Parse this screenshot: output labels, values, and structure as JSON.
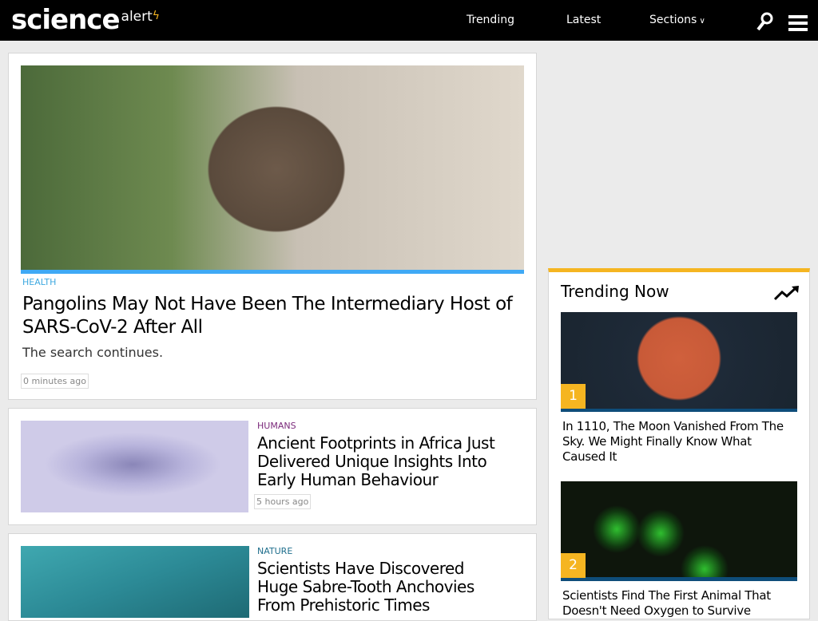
{
  "header": {
    "logo_main": "science",
    "logo_sub": "alert",
    "nav": [
      "Trending",
      "Latest",
      "Sections"
    ]
  },
  "featured": {
    "category": "HEALTH",
    "title": "Pangolins May Not Have Been The Intermediary Host of SARS-CoV-2 After All",
    "subtitle": "The search continues.",
    "time": "0 minutes ago",
    "category_color": "#3fa9e0"
  },
  "articles": [
    {
      "category": "HUMANS",
      "title": "Ancient Footprints in Africa Just Delivered Unique Insights Into Early Human Behaviour",
      "time": "5 hours ago",
      "category_color": "#7b2a7b"
    },
    {
      "category": "NATURE",
      "title": "Scientists Have Discovered Huge Sabre-Tooth Anchovies From Prehistoric Times",
      "category_color": "#1e6e8c"
    }
  ],
  "trending": {
    "title": "Trending Now",
    "items": [
      {
        "rank": "1",
        "title": "In 1110, The Moon Vanished From The Sky. We Might Finally Know What Caused It"
      },
      {
        "rank": "2",
        "title": "Scientists Find The First Animal That Doesn't Need Oxygen to Survive"
      }
    ]
  },
  "colors": {
    "accent": "#f5b521",
    "health": "#3fa9f5"
  }
}
